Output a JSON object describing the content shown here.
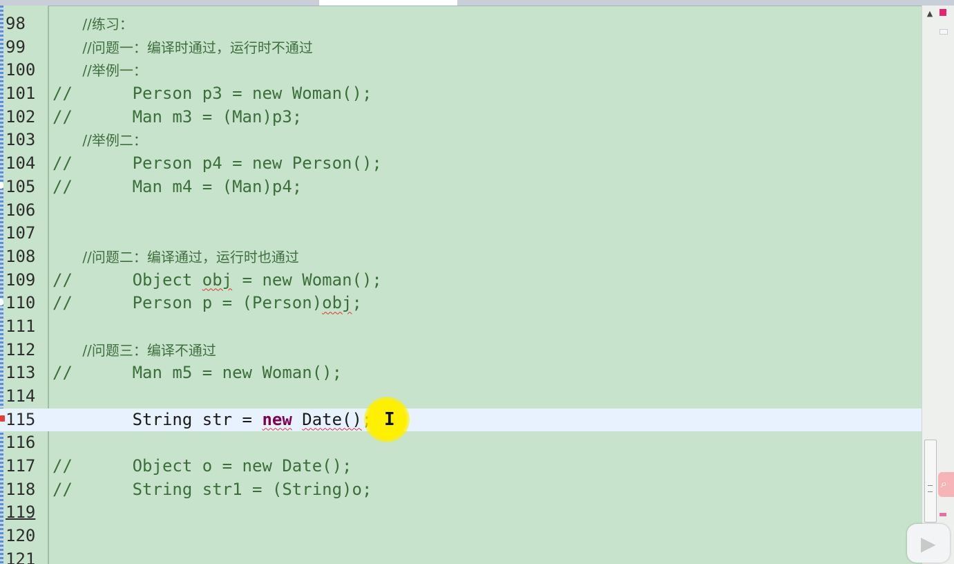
{
  "editor": {
    "lines": [
      {
        "number": "98",
        "prefix": "",
        "indent": "   ",
        "parts": [
          {
            "text": "//练习：",
            "cls": "zh"
          }
        ]
      },
      {
        "number": "99",
        "prefix": "",
        "indent": "   ",
        "parts": [
          {
            "text": "//问题一：编译时通过，运行时不通过",
            "cls": "zh"
          }
        ]
      },
      {
        "number": "100",
        "prefix": "",
        "indent": "   ",
        "parts": [
          {
            "text": "//举例一：",
            "cls": "zh"
          }
        ]
      },
      {
        "number": "101",
        "prefix": "//",
        "indent": "      ",
        "parts": [
          {
            "text": "Person p3 = new Woman();",
            "cls": "cm"
          }
        ]
      },
      {
        "number": "102",
        "prefix": "//",
        "indent": "      ",
        "parts": [
          {
            "text": "Man m3 = (Man)p3;",
            "cls": "cm"
          }
        ]
      },
      {
        "number": "103",
        "prefix": "",
        "indent": "   ",
        "parts": [
          {
            "text": "//举例二：",
            "cls": "zh"
          }
        ]
      },
      {
        "number": "104",
        "prefix": "//",
        "indent": "      ",
        "parts": [
          {
            "text": "Person p4 = new Person();",
            "cls": "cm"
          }
        ]
      },
      {
        "number": "105",
        "prefix": "//",
        "indent": "      ",
        "parts": [
          {
            "text": "Man m4 = (Man)p4;",
            "cls": "cm"
          }
        ]
      },
      {
        "number": "106",
        "prefix": "",
        "indent": "",
        "parts": []
      },
      {
        "number": "107",
        "prefix": "",
        "indent": "",
        "parts": []
      },
      {
        "number": "108",
        "prefix": "",
        "indent": "   ",
        "parts": [
          {
            "text": "//问题二：编译通过，运行时也通过",
            "cls": "zh"
          }
        ]
      },
      {
        "number": "109",
        "prefix": "//",
        "indent": "      ",
        "parts": [
          {
            "text": "Object ",
            "cls": "cm"
          },
          {
            "text": "obj",
            "cls": "cm squiggle"
          },
          {
            "text": " = new Woman();",
            "cls": "cm"
          }
        ]
      },
      {
        "number": "110",
        "prefix": "//",
        "indent": "      ",
        "parts": [
          {
            "text": "Person p = (Person)",
            "cls": "cm"
          },
          {
            "text": "obj",
            "cls": "cm squiggle"
          },
          {
            "text": ";",
            "cls": "cm"
          }
        ]
      },
      {
        "number": "111",
        "prefix": "",
        "indent": "",
        "parts": []
      },
      {
        "number": "112",
        "prefix": "",
        "indent": "   ",
        "parts": [
          {
            "text": "//问题三：编译不通过",
            "cls": "zh"
          }
        ]
      },
      {
        "number": "113",
        "prefix": "//",
        "indent": "      ",
        "parts": [
          {
            "text": "Man m5 = new Woman();",
            "cls": "cm"
          }
        ]
      },
      {
        "number": "114",
        "prefix": "",
        "indent": "",
        "parts": []
      },
      {
        "number": "115",
        "prefix": "",
        "indent": "        ",
        "current": true,
        "parts": [
          {
            "text": "String str = ",
            "cls": "plain"
          },
          {
            "text": "new",
            "cls": "kw squiggle"
          },
          {
            "text": " ",
            "cls": "plain"
          },
          {
            "text": "Date()",
            "cls": "plain squiggle"
          },
          {
            "text": ";",
            "cls": "plain"
          }
        ]
      },
      {
        "number": "116",
        "prefix": "",
        "indent": "",
        "parts": []
      },
      {
        "number": "117",
        "prefix": "//",
        "indent": "      ",
        "parts": [
          {
            "text": "Object o = new Date();",
            "cls": "cm"
          }
        ]
      },
      {
        "number": "118",
        "prefix": "//",
        "indent": "      ",
        "parts": [
          {
            "text": "String str1 = (String)o;",
            "cls": "cm"
          }
        ]
      },
      {
        "number": "119",
        "prefix": "",
        "indent": "",
        "parts": [],
        "cursor_line": true
      },
      {
        "number": "120",
        "prefix": "",
        "indent": "",
        "parts": []
      },
      {
        "number": "121",
        "prefix": "",
        "indent": "",
        "parts": []
      }
    ]
  },
  "scrollbar": {
    "up_arrow": "▲",
    "search_icon": "⌕",
    "play_icon": "▶"
  },
  "cursor_glyph": "I",
  "colors": {
    "background": "#c7e3cb",
    "current_line": "#e8f2fe",
    "keyword": "#7f0055",
    "comment": "#3b6e3b",
    "error": "#e0302d"
  }
}
